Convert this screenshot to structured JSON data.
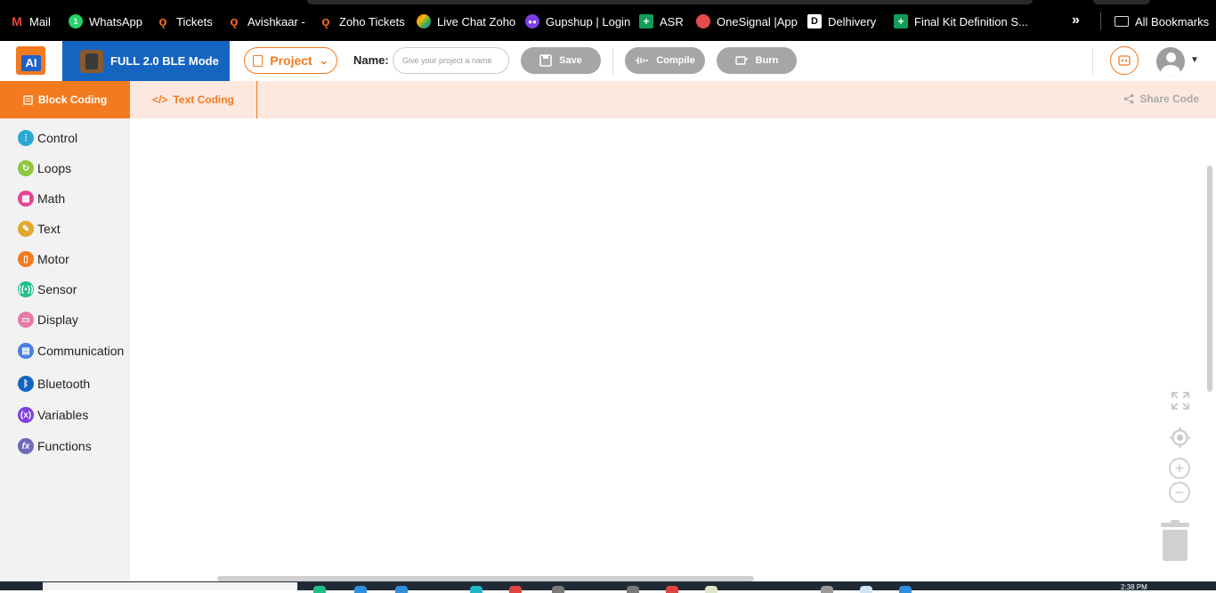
{
  "bookmarks": [
    {
      "label": "Mail",
      "icon": "gmail-icon"
    },
    {
      "label": "WhatsApp",
      "icon": "whatsapp-icon"
    },
    {
      "label": "Tickets",
      "icon": "zoho-icon"
    },
    {
      "label": "Avishkaar -",
      "icon": "zoho-icon"
    },
    {
      "label": "Zoho Tickets",
      "icon": "zoho-icon"
    },
    {
      "label": "Live Chat Zoho",
      "icon": "chat-icon"
    },
    {
      "label": "Gupshup | Login",
      "icon": "gupshup-icon"
    },
    {
      "label": "ASR",
      "icon": "sheets-icon"
    },
    {
      "label": "OneSignal |App",
      "icon": "onesignal-icon"
    },
    {
      "label": "Delhivery",
      "icon": "delhivery-icon"
    },
    {
      "label": "Final Kit Definition S...",
      "icon": "sheets-icon"
    }
  ],
  "bookmarks_more": "»",
  "all_bookmarks": "All Bookmarks",
  "header": {
    "logo_text": "AI",
    "mode_label": "FULL 2.0 BLE Mode",
    "project_label": "Project",
    "project_caret": "⌄",
    "name_label": "Name:",
    "name_placeholder": "Give your project a name",
    "name_value": "",
    "save_label": "Save",
    "compile_label": "Compile",
    "burn_label": "Burn",
    "avatar_caret": "▼"
  },
  "tabs": {
    "block_coding": "Block Coding",
    "text_coding": "Text Coding",
    "share_code": "Share Code"
  },
  "categories": [
    {
      "label": "Control",
      "color": "#29a8d6"
    },
    {
      "label": "Loops",
      "color": "#8dc63f"
    },
    {
      "label": "Math",
      "color": "#e84393"
    },
    {
      "label": "Text",
      "color": "#e0a82e"
    },
    {
      "label": "Motor",
      "color": "#f47a20"
    },
    {
      "label": "Sensor",
      "color": "#21c08b"
    },
    {
      "label": "Display",
      "color": "#e879a4"
    },
    {
      "label": "Communication",
      "color": "#4a7fe0"
    },
    {
      "label": "Bluetooth",
      "color": "#1565c0"
    },
    {
      "label": "Variables",
      "color": "#7e3fe0"
    },
    {
      "label": "Functions",
      "color": "#7068b8"
    }
  ],
  "workspace_controls": {
    "zoom_in": "+",
    "zoom_out": "−"
  },
  "taskbar": {
    "clock": "2:38 PM"
  },
  "colors": {
    "accent": "#f47a20",
    "mode_blue": "#1565c0",
    "button_gray": "#a6a6a6",
    "tab_bg": "#fde8df"
  }
}
